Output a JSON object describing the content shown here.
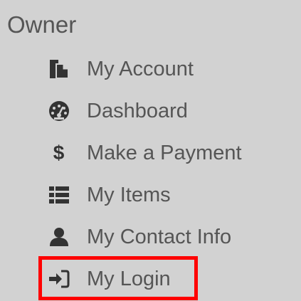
{
  "section": {
    "title": "Owner"
  },
  "menu": {
    "items": [
      {
        "label": "My Account",
        "icon": "copy-document-icon"
      },
      {
        "label": "Dashboard",
        "icon": "dashboard-gauge-icon"
      },
      {
        "label": "Make a Payment",
        "icon": "dollar-icon",
        "icon_glyph": "$"
      },
      {
        "label": "My Items",
        "icon": "list-icon"
      },
      {
        "label": "My Contact Info",
        "icon": "user-icon"
      },
      {
        "label": "My Login",
        "icon": "sign-in-icon",
        "highlighted": true
      }
    ]
  },
  "colors": {
    "panel_background": "#d2d2d2",
    "text": "#555555",
    "icon": "#333333",
    "highlight_border": "#ff0000"
  }
}
